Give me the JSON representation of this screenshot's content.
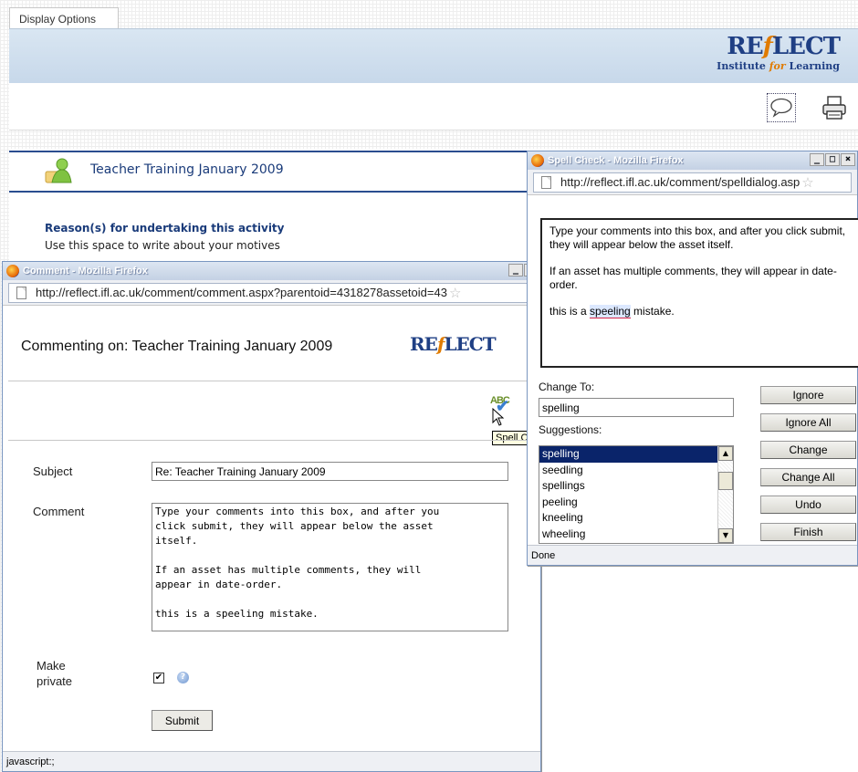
{
  "background": {
    "tab_label": "Display Options",
    "brand_name_pre": "RE",
    "brand_name_f": "f",
    "brand_name_post": "LECT",
    "brand_sub_pre": "Institute ",
    "brand_sub_for": "for",
    "brand_sub_post": " Learning",
    "activity_title": "Teacher Training January 2009",
    "reason_title": "Reason(s) for undertaking this activity",
    "reason_text": "Use this space to write about your motives"
  },
  "comment_window": {
    "title": "Comment - Mozilla Firefox",
    "controls": [
      "_",
      "□",
      "×"
    ],
    "url": "http://reflect.ifl.ac.uk/comment/comment.aspx?parentoid=4318278assetoid=43",
    "heading": "Commenting on: Teacher Training January 2009",
    "logo_pre": "RE",
    "logo_f": "f",
    "logo_post": "LECT",
    "spellcheck_icon_text": "ABC",
    "tooltip": "Spell Check",
    "subject_label": "Subject",
    "subject_value": "Re: Teacher Training January 2009",
    "comment_label": "Comment",
    "comment_value": "Type your comments into this box, and after you\nclick submit, they will appear below the asset\nitself.\n\nIf an asset has multiple comments, they will\nappear in date-order.\n\nthis is a speeling mistake.",
    "private_label": "Make private",
    "private_checked_mark": "✔",
    "help_glyph": "?",
    "submit_label": "Submit",
    "status_text": "javascript:;"
  },
  "spell_window": {
    "title": "Spell Check - Mozilla Firefox",
    "controls": [
      "_",
      "□",
      "×"
    ],
    "url": "http://reflect.ifl.ac.uk/comment/spelldialog.asp",
    "preview": {
      "para1": "Type your comments into this box, and after you click submit, they will appear below the asset itself.",
      "para2": "If an asset has multiple comments, they will appear in date-order.",
      "para3_pre": "this is a ",
      "para3_word": "speeling",
      "para3_post": " mistake."
    },
    "change_to_label": "Change To:",
    "change_to_value": "spelling",
    "suggestions_label": "Suggestions:",
    "suggestions": [
      "spelling",
      "seedling",
      "spellings",
      "peeling",
      "kneeling",
      "wheeling"
    ],
    "selected_suggestion": "spelling",
    "buttons": {
      "ignore": "Ignore",
      "ignore_all": "Ignore All",
      "change": "Change",
      "change_all": "Change All",
      "undo": "Undo",
      "finish": "Finish"
    },
    "status_text": "Done"
  },
  "colors": {
    "brand_blue": "#1f3f84",
    "brand_orange": "#e07b00",
    "selection": "#0a246a"
  }
}
